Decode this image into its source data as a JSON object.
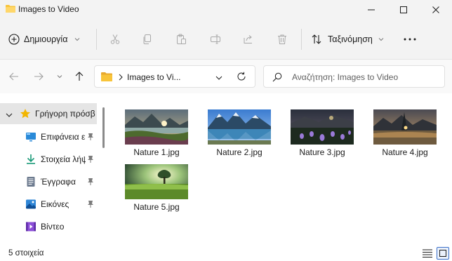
{
  "window": {
    "title": "Images to Video"
  },
  "toolbar": {
    "new_label": "Δημιουργία",
    "sort_label": "Ταξινόμηση"
  },
  "address": {
    "crumb": "Images to Vi..."
  },
  "search": {
    "placeholder": "Αναζήτηση: Images to Video"
  },
  "sidebar": {
    "quick_access": "Γρήγορη πρόσβα",
    "items": [
      {
        "label": "Επιφάνεια ερ",
        "icon": "desktop-icon",
        "pinned": true
      },
      {
        "label": "Στοιχεία λήψ",
        "icon": "downloads-icon",
        "pinned": true
      },
      {
        "label": "Έγγραφα",
        "icon": "documents-icon",
        "pinned": true
      },
      {
        "label": "Εικόνες",
        "icon": "pictures-icon",
        "pinned": true
      },
      {
        "label": "Βίντεο",
        "icon": "videos-icon",
        "pinned": false
      }
    ]
  },
  "files": [
    {
      "name": "Nature 1.jpg"
    },
    {
      "name": "Nature 2.jpg"
    },
    {
      "name": "Nature 3.jpg"
    },
    {
      "name": "Nature 4.jpg"
    },
    {
      "name": "Nature 5.jpg"
    }
  ],
  "status": {
    "count": "5 στοιχεία"
  },
  "colors": {
    "accent": "#0067c0",
    "folder": "#f8c43a",
    "star": "#f2b600"
  }
}
